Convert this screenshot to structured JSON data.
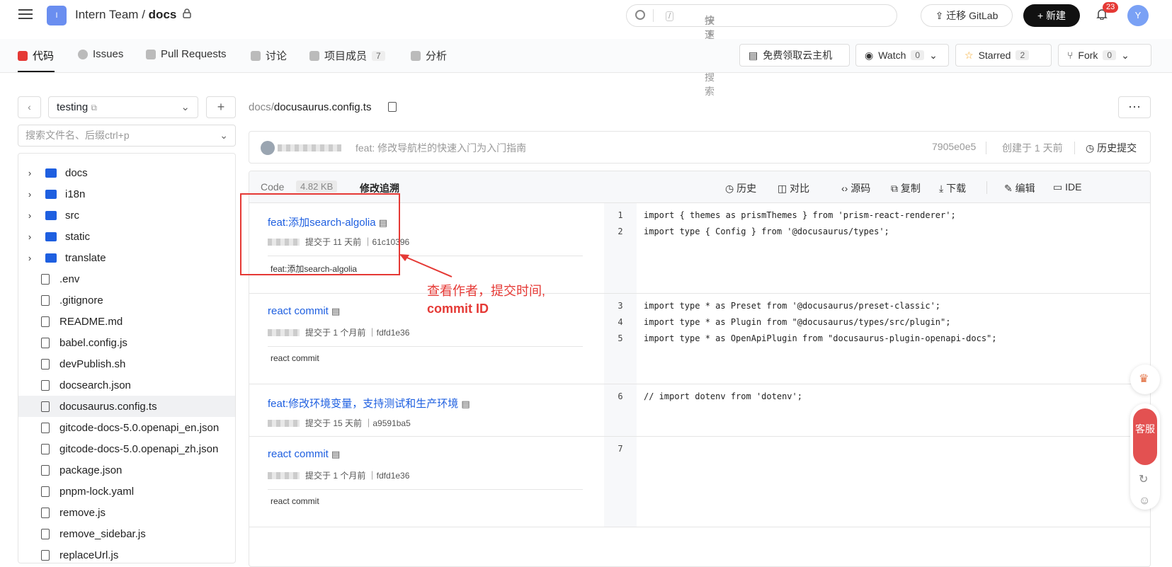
{
  "header": {
    "logo_letter": "I",
    "org": "Intern Team",
    "sep": "/",
    "repo": "docs",
    "search_placeholder": "按下",
    "search_key": "/",
    "search_hint": "快速开启搜索",
    "gitlab": "迁移 GitLab",
    "new": "新建",
    "notify_count": "23",
    "avatar": "Y"
  },
  "tabs": [
    {
      "label": "代码"
    },
    {
      "label": "Issues"
    },
    {
      "label": "Pull Requests"
    },
    {
      "label": "讨论"
    },
    {
      "label": "项目成员",
      "count": "7"
    },
    {
      "label": "分析"
    }
  ],
  "actions": {
    "cloud": "免费领取云主机",
    "watch": "Watch",
    "watch_count": "0",
    "starred": "Starred",
    "star_count": "2",
    "fork": "Fork",
    "fork_count": "0"
  },
  "sidebar": {
    "branch": "testing",
    "file_search": "搜索文件名、后缀ctrl+p",
    "files": [
      {
        "name": "docs",
        "type": "folder"
      },
      {
        "name": "i18n",
        "type": "folder"
      },
      {
        "name": "src",
        "type": "folder"
      },
      {
        "name": "static",
        "type": "folder"
      },
      {
        "name": "translate",
        "type": "folder"
      },
      {
        "name": ".env",
        "type": "file"
      },
      {
        "name": ".gitignore",
        "type": "file"
      },
      {
        "name": "README.md",
        "type": "file"
      },
      {
        "name": "babel.config.js",
        "type": "file"
      },
      {
        "name": "devPublish.sh",
        "type": "file"
      },
      {
        "name": "docsearch.json",
        "type": "file"
      },
      {
        "name": "docusaurus.config.ts",
        "type": "file",
        "selected": true
      },
      {
        "name": "gitcode-docs-5.0.openapi_en.json",
        "type": "file"
      },
      {
        "name": "gitcode-docs-5.0.openapi_zh.json",
        "type": "file"
      },
      {
        "name": "package.json",
        "type": "file"
      },
      {
        "name": "pnpm-lock.yaml",
        "type": "file"
      },
      {
        "name": "remove.js",
        "type": "file"
      },
      {
        "name": "remove_sidebar.js",
        "type": "file"
      },
      {
        "name": "replaceUrl.js",
        "type": "file"
      }
    ]
  },
  "main": {
    "path_dir": "docs",
    "path_sep": "/",
    "path_file": "docusaurus.config.ts",
    "more": "···",
    "last_commit": {
      "message": "feat: 修改导航栏的快速入门为入门指南",
      "sha": "7905e0e5",
      "time": "创建于 1 天前",
      "history": "历史提交"
    },
    "code_label": "Code",
    "code_size": "4.82 KB",
    "blame_label": "修改追溯",
    "toolbar": [
      "历史",
      "对比",
      "源码",
      "复制",
      "下载",
      "编辑",
      "IDE"
    ],
    "blocks": [
      {
        "title": "feat:添加search-algolia",
        "meta": "提交于 11 天前 ｜61c10396",
        "body": "feat:添加search-algolia",
        "lines": [
          {
            "n": "1",
            "code": "import { themes as prismThemes } from 'prism-react-renderer';"
          },
          {
            "n": "2",
            "code": "import type { Config } from '@docusaurus/types';"
          }
        ]
      },
      {
        "title": "react commit",
        "meta": "提交于 1 个月前 ｜fdfd1e36",
        "body": "react commit",
        "lines": [
          {
            "n": "3",
            "code": "import type * as Preset from '@docusaurus/preset-classic';"
          },
          {
            "n": "4",
            "code": "import type * as Plugin from \"@docusaurus/types/src/plugin\";"
          },
          {
            "n": "5",
            "code": "import type * as OpenApiPlugin from \"docusaurus-plugin-openapi-docs\";"
          }
        ]
      },
      {
        "title": "feat:修改环境变量，支持测试和生产环境",
        "meta": "提交于 15 天前 ｜a9591ba5",
        "body": "",
        "lines": [
          {
            "n": "6",
            "code": "// import dotenv from 'dotenv';"
          }
        ]
      },
      {
        "title": "react commit",
        "meta": "提交于 1 个月前 ｜fdfd1e36",
        "body": "react commit",
        "lines": [
          {
            "n": "7",
            "code": ""
          }
        ]
      }
    ]
  },
  "annotation": {
    "line1": "查看作者，提交时间,",
    "line2": "commit ID"
  },
  "float": {
    "service": "客服"
  },
  "colors": {
    "accent": "#1e5fe0",
    "annotation": "#e53935"
  }
}
